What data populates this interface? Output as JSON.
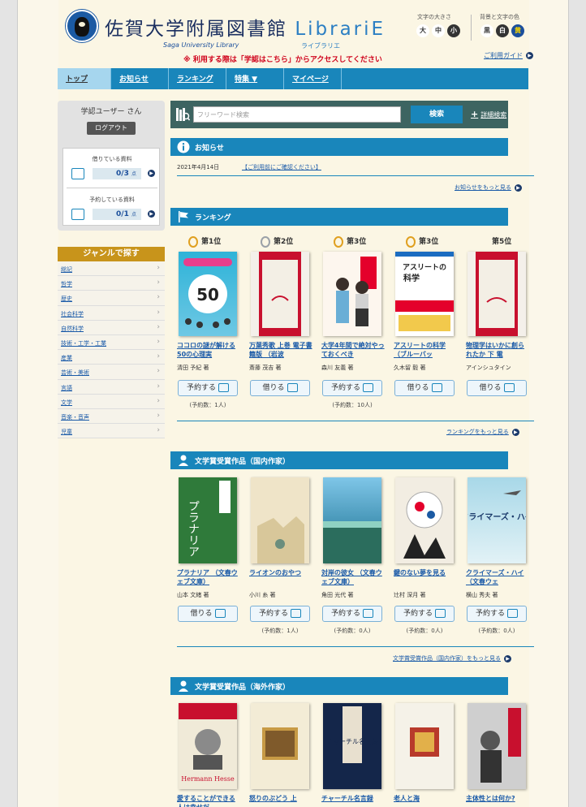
{
  "header": {
    "title_jp": "佐賀大学附属図書館",
    "title_brand": "LibrariE",
    "sub_en": "Saga University Library",
    "sub_ruby": "ライブラリエ",
    "notice": "※ 利用する際は「学認はこちら」からアクセスしてください",
    "font_size_label": "文字の大きさ",
    "font_sizes": [
      "大",
      "中",
      "小"
    ],
    "color_label": "背景と文字の色",
    "colors": [
      "黒",
      "白",
      "黄"
    ],
    "guide_link": "ご利用ガイド"
  },
  "nav": {
    "items": [
      "トップ",
      "お知らせ",
      "ランキング",
      "特集 ▼",
      "マイページ"
    ]
  },
  "sidebar": {
    "user_name": "学認ユーザー さん",
    "logout": "ログアウト",
    "borrowed_label": "借りている資料",
    "borrowed_value": "0",
    "borrowed_total": "/3",
    "reserved_label": "予約している資料",
    "reserved_value": "0",
    "reserved_total": "/1",
    "count_unit": "点",
    "genre_title": "ジャンルで探す",
    "genres": [
      "総記",
      "哲学",
      "歴史",
      "社会科学",
      "自然科学",
      "技術・工学・工業",
      "産業",
      "芸術・美術",
      "言語",
      "文学",
      "音楽・音声",
      "児童"
    ]
  },
  "search": {
    "placeholder": "フリーワード検索",
    "button": "検索",
    "advanced": "詳細検索"
  },
  "news": {
    "title": "お知らせ",
    "date": "2021年4月14日",
    "link": "【ご利用前にご確認ください】",
    "more": "お知らせをもっと見る"
  },
  "ranking": {
    "title": "ランキング",
    "ranks": [
      "第1位",
      "第2位",
      "第3位",
      "第3位",
      "第5位"
    ],
    "books": [
      {
        "title": "ココロの謎が解ける50の心理実",
        "author": "清田 予紀 著",
        "button": "予約する",
        "count": "(予約数：1人)"
      },
      {
        "title": "万葉秀歌 上巻 電子書籍版 （岩波",
        "author": "斎藤 茂吉 著",
        "button": "借りる",
        "count": ""
      },
      {
        "title": "大学4年間で絶対やっておくべき",
        "author": "森川 友義 著",
        "button": "予約する",
        "count": "(予約数：10人)"
      },
      {
        "title": "アスリートの科学 （ブルーバッ",
        "author": "久木留 毅 著",
        "button": "借りる",
        "count": ""
      },
      {
        "title": "物理学はいかに創られたか 下 電",
        "author": "アインシュタイン",
        "button": "借りる",
        "count": ""
      }
    ],
    "more": "ランキングをもっと見る"
  },
  "domestic": {
    "title": "文学賞受賞作品（国内作家）",
    "books": [
      {
        "title": "プラナリア （文春ウェブ文庫）",
        "author": "山本 文緒 著",
        "button": "借りる",
        "count": ""
      },
      {
        "title": "ライオンのおやつ",
        "author": "小川 糸 著",
        "button": "予約する",
        "count": "(予約数：1人)"
      },
      {
        "title": "対岸の彼女 （文春ウェブ文庫）",
        "author": "角田 光代 著",
        "button": "予約する",
        "count": "(予約数：0人)"
      },
      {
        "title": "鍵のない夢を見る",
        "author": "辻村 深月 著",
        "button": "予約する",
        "count": "(予約数：0人)"
      },
      {
        "title": "クライマーズ・ハイ （文春ウェ",
        "author": "横山 秀夫 著",
        "button": "予約する",
        "count": "(予約数：0人)"
      }
    ],
    "covers": [
      "プラナリア",
      "ライオンのおやつ",
      "対岸の彼女",
      "鍵のない夢を見る",
      "クライマーズ・ハイ"
    ],
    "more": "文学賞受賞作品（国内作家）をもっと見る"
  },
  "foreign": {
    "title": "文学賞受賞作品（海外作家）",
    "books": [
      {
        "title": "愛することができる人は幸せだ"
      },
      {
        "title": "怒りのぶどう 上"
      },
      {
        "title": "チャーチル名言録"
      },
      {
        "title": "老人と海"
      },
      {
        "title": "主体性とは何か?"
      }
    ],
    "covers": [
      "Hermann Hesse",
      "チャーチル名言録"
    ]
  },
  "colors": {
    "nav": "#1986bb",
    "genre": "#c8941b",
    "search": "#3d6461",
    "accent_red": "#d0021b"
  }
}
